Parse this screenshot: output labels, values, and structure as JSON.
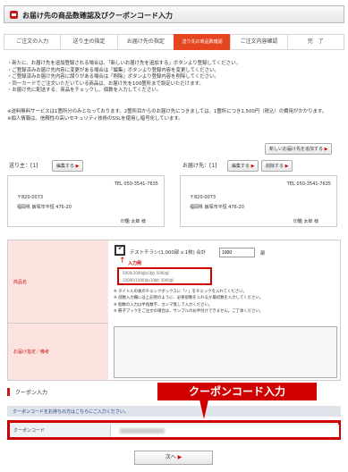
{
  "title": "お届け先の商品数確認及びクーポンコード入力",
  "steps": [
    "ご注文の入力",
    "送り主の指定",
    "お届け先の指定",
    "送り先の商品数確認",
    "ご注文内容確認",
    "完　了"
  ],
  "notes": [
    "・新たに、お届け先を追加登録される場合は、「新しいお届け先を追加する」ボタンより登録してください。",
    "・ご登録済みお届け先内容に変更がある場合は「編集」ボタンより登録内容を変更してください。",
    "・ご登録済みお届け先内容に誤りがある場合は「削除」ボタンより登録内容を削除してください。",
    "・同一カードでご注文いただいている商品は、お届け先を100箇所まで設定いただけます。",
    "・お届け先に配送する、商品をチェックし、個数を入力してください。"
  ],
  "notes2": [
    "※送料無料サービスは1箇所分のみとなっております。2箇所目からのお届け先につきましては、1箇所につき1,500円（税込）の費用がかかります。",
    "※個人情報は、信頼性の高いセキュリティ技術のSSLを使用し暗号化しています。"
  ],
  "add_address_button": "新しいお届け先を追加する",
  "sender": {
    "label": "送り主：[1]",
    "edit": "編集する",
    "tel": "TEL 050-3541-7635",
    "zip": "〒820-0073",
    "address": "福岡県 飯塚市平恒 476-20",
    "name": "印鑑 太郎 様"
  },
  "destination": {
    "label": "お届け先：[1]",
    "edit": "編集する",
    "delete": "削除する",
    "tel": "TEL 050-3541-7635",
    "zip": "〒820-0073",
    "address": "福岡県 飯塚市平恒 476-20",
    "name": "印鑑 太郎 様"
  },
  "item": {
    "row_label": "商品名",
    "product": "テストチラシ(1,000部 x 1枚) 合計",
    "qty": "1000",
    "unit": "部",
    "input_note": "入力例",
    "opt1": "5000(1000部x5枚)  5000部",
    "opt2": "10000(1000部x10枚)  5000部",
    "bullets": [
      "※ タイトルの後のチェックボックスに「✓」をチェックを入れてください。",
      "※ 部数入力欄には上記例のように、必要部数を入れるか最初数を入力してください。",
      "※ 個数の入力は半角数字、カンマ無しで入力ください。",
      "※ 冊子ブックをご注文の場合は、サンプルのお申付けできません。ご了承ください。"
    ],
    "memo_label": "お届け指定／備考"
  },
  "coupon": {
    "header": "クーポン入力",
    "note": "クーポンコードをお持ちの方はこちらにご入力ください。",
    "label": "クーポンコード",
    "callout": "クーポンコード入力"
  },
  "next_button": "次へ",
  "colors": {
    "brand_red": "#c8161d",
    "active_step": "#e5451f",
    "coupon_bg": "#dfe3ea"
  }
}
